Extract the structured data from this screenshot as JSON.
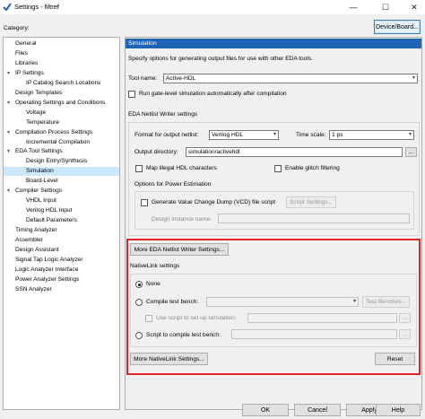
{
  "window": {
    "title": "Settings - filtref",
    "minimize_glyph": "—",
    "maximize_glyph": "☐",
    "close_glyph": "✕"
  },
  "category_label": "Category:",
  "device_board_button": "Device/Board...",
  "tree": [
    {
      "label": "General",
      "depth": 0,
      "expandable": false
    },
    {
      "label": "Files",
      "depth": 0,
      "expandable": false
    },
    {
      "label": "Libraries",
      "depth": 0,
      "expandable": false
    },
    {
      "label": "IP Settings",
      "depth": 0,
      "expandable": true
    },
    {
      "label": "IP Catalog Search Locations",
      "depth": 1,
      "expandable": false
    },
    {
      "label": "Design Templates",
      "depth": 0,
      "expandable": false
    },
    {
      "label": "Operating Settings and Conditions",
      "depth": 0,
      "expandable": true
    },
    {
      "label": "Voltage",
      "depth": 1,
      "expandable": false
    },
    {
      "label": "Temperature",
      "depth": 1,
      "expandable": false
    },
    {
      "label": "Compilation Process Settings",
      "depth": 0,
      "expandable": true
    },
    {
      "label": "Incremental Compilation",
      "depth": 1,
      "expandable": false
    },
    {
      "label": "EDA Tool Settings",
      "depth": 0,
      "expandable": true
    },
    {
      "label": "Design Entry/Synthesis",
      "depth": 1,
      "expandable": false
    },
    {
      "label": "Simulation",
      "depth": 1,
      "expandable": false,
      "selected": true
    },
    {
      "label": "Board-Level",
      "depth": 1,
      "expandable": false
    },
    {
      "label": "Compiler Settings",
      "depth": 0,
      "expandable": true
    },
    {
      "label": "VHDL Input",
      "depth": 1,
      "expandable": false
    },
    {
      "label": "Verilog HDL Input",
      "depth": 1,
      "expandable": false
    },
    {
      "label": "Default Parameters",
      "depth": 1,
      "expandable": false
    },
    {
      "label": "Timing Analyzer",
      "depth": 0,
      "expandable": false
    },
    {
      "label": "Assembler",
      "depth": 0,
      "expandable": false
    },
    {
      "label": "Design Assistant",
      "depth": 0,
      "expandable": false
    },
    {
      "label": "Signal Tap Logic Analyzer",
      "depth": 0,
      "expandable": false
    },
    {
      "label": "Logic Analyzer Interface",
      "depth": 0,
      "expandable": false
    },
    {
      "label": "Power Analyzer Settings",
      "depth": 0,
      "expandable": false
    },
    {
      "label": "SSN Analyzer",
      "depth": 0,
      "expandable": false
    }
  ],
  "panel": {
    "header": "Simulation",
    "description": "Specify options for generating output files for use with other EDA tools.",
    "tool_name_label": "Tool name:",
    "tool_name_value": "Active-HDL",
    "run_gate_level": "Run gate-level simulation automatically after compilation",
    "netlist_section": "EDA Netlist Writer settings",
    "format_label": "Format for output netlist:",
    "format_value": "Verilog HDL",
    "time_scale_label": "Time scale:",
    "time_scale_value": "1 ps",
    "output_dir_label": "Output directory:",
    "output_dir_value": "simulation/activehdl",
    "map_illegal": "Map illegal HDL characters",
    "enable_glitch": "Enable glitch filtering",
    "power_section": "Options for Power Estimation",
    "generate_vcd": "Generate Value Change Dump (VCD) file script",
    "script_settings_btn": "Script Settings...",
    "design_instance_label": "Design instance name:",
    "more_eda_btn": "More EDA Netlist Writer Settings...",
    "nativelink_section": "NativeLink settings",
    "none_option": "None",
    "compile_test_bench": "Compile test bench:",
    "test_benches_btn": "Test Benches...",
    "use_script": "Use script to set up simulation:",
    "script_compile": "Script to compile test bench:",
    "ellipsis": "...",
    "more_nativelink_btn": "More NativeLink Settings...",
    "reset_btn": "Reset"
  },
  "footer": {
    "ok": "OK",
    "cancel": "Cancel",
    "apply": "Apply",
    "help": "Help"
  },
  "colors": {
    "header_blue": "#1f63b8",
    "highlight_red": "#e3242b",
    "selection": "#cce8ff"
  }
}
